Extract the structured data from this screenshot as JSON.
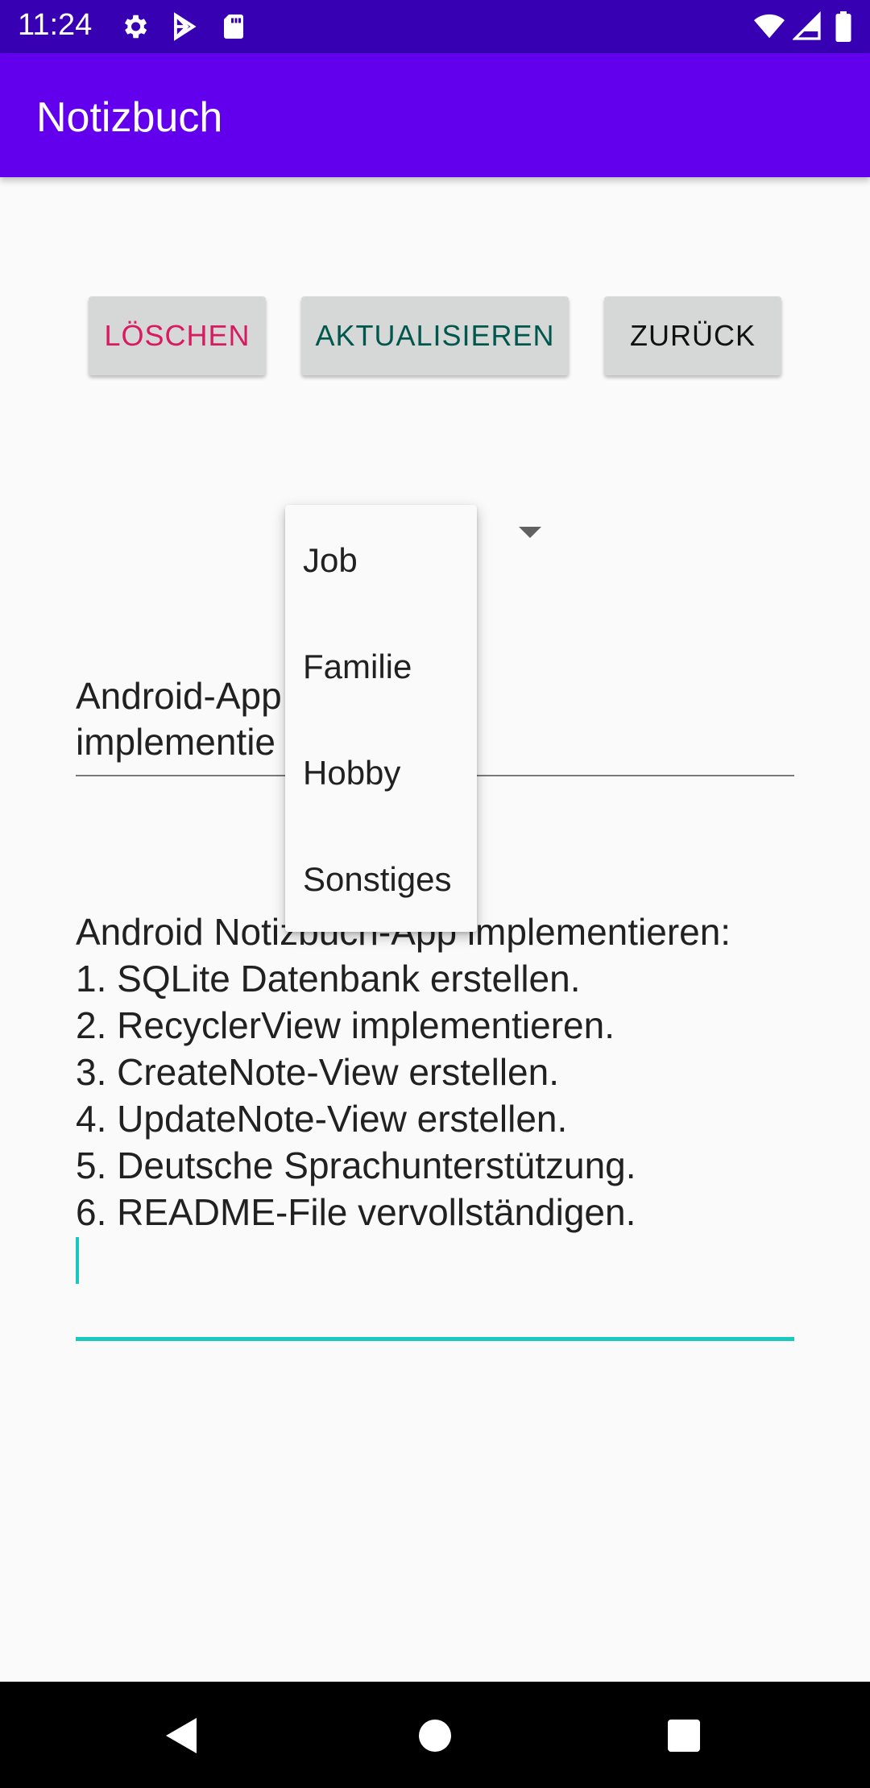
{
  "status_bar": {
    "time": "11:24",
    "icons": [
      "gear-icon",
      "play-store-icon",
      "sd-card-icon",
      "wifi-icon",
      "signal-icon",
      "battery-icon"
    ]
  },
  "app_bar": {
    "title": "Notizbuch"
  },
  "buttons": {
    "delete": "LÖSCHEN",
    "update": "AKTUALISIEREN",
    "back": "ZURÜCK"
  },
  "colors": {
    "status_bar": "#3700b3",
    "app_bar": "#6200ee",
    "delete_text": "#d81b60",
    "update_text": "#00574b",
    "accent": "#18c9c0"
  },
  "spinner": {
    "options": [
      "Job",
      "Familie",
      "Hobby",
      "Sonstiges"
    ]
  },
  "note": {
    "title_visible": "Android-App                  ch\"\nimplementie",
    "content": "Android Notizbuch-App implementieren:\n1. SQLite Datenbank erstellen.\n2. RecyclerView implementieren.\n3. CreateNote-View erstellen.\n4. UpdateNote-View erstellen.\n5. Deutsche Sprachunterstützung.\n6. README-File vervollständigen."
  },
  "nav_bar": {
    "icons": [
      "back-icon",
      "home-icon",
      "recents-icon"
    ]
  }
}
